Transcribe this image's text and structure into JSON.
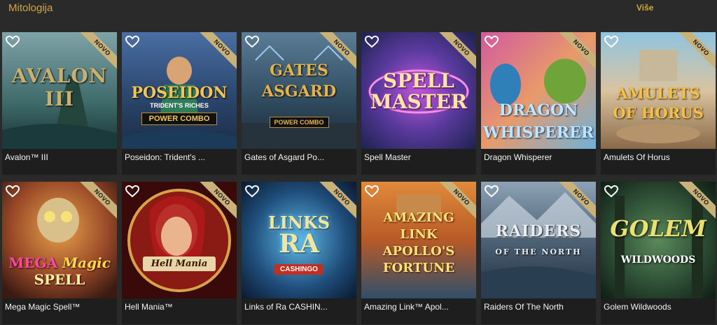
{
  "section": {
    "title": "Mitologija",
    "more_label": "Više"
  },
  "badge_label": "NOVO",
  "icons": {
    "favorite": "heart-outline-icon"
  },
  "colors": {
    "accent": "#d2a83a",
    "badge": "#c8b27a",
    "background": "#2a2a2a"
  },
  "games": [
    {
      "title": "Avalon™ III",
      "logo": "AVALON III"
    },
    {
      "title": "Poseidon: Trident's ...",
      "logo": "POSEIDON",
      "sub": "TRIDENT'S RICHES",
      "tag": "POWER COMBO"
    },
    {
      "title": "Gates of Asgard Po...",
      "logo": "GATES OF ASGARD",
      "tag": "POWER COMBO"
    },
    {
      "title": "Spell Master",
      "logo": "SPELL MASTER"
    },
    {
      "title": "Dragon Whisperer",
      "logo": "DRAGON WHISPERER"
    },
    {
      "title": "Amulets Of Horus",
      "logo": "AMULETS OF HORUS"
    },
    {
      "title": "Mega Magic Spell™",
      "logo": "MEGA Magic SPELL"
    },
    {
      "title": "Hell Mania™",
      "logo": "Hell Mania"
    },
    {
      "title": "Links of Ra CASHIN...",
      "logo": "LINKS OF RA",
      "tag": "CASHINGO"
    },
    {
      "title": "Amazing Link™ Apol...",
      "logo": "AMAZING LINK APOLLO'S FORTUNE"
    },
    {
      "title": "Raiders Of The North",
      "logo": "RAIDERS OF THE NORTH"
    },
    {
      "title": "Golem Wildwoods",
      "logo": "GOLEM WILDWOODS"
    }
  ]
}
